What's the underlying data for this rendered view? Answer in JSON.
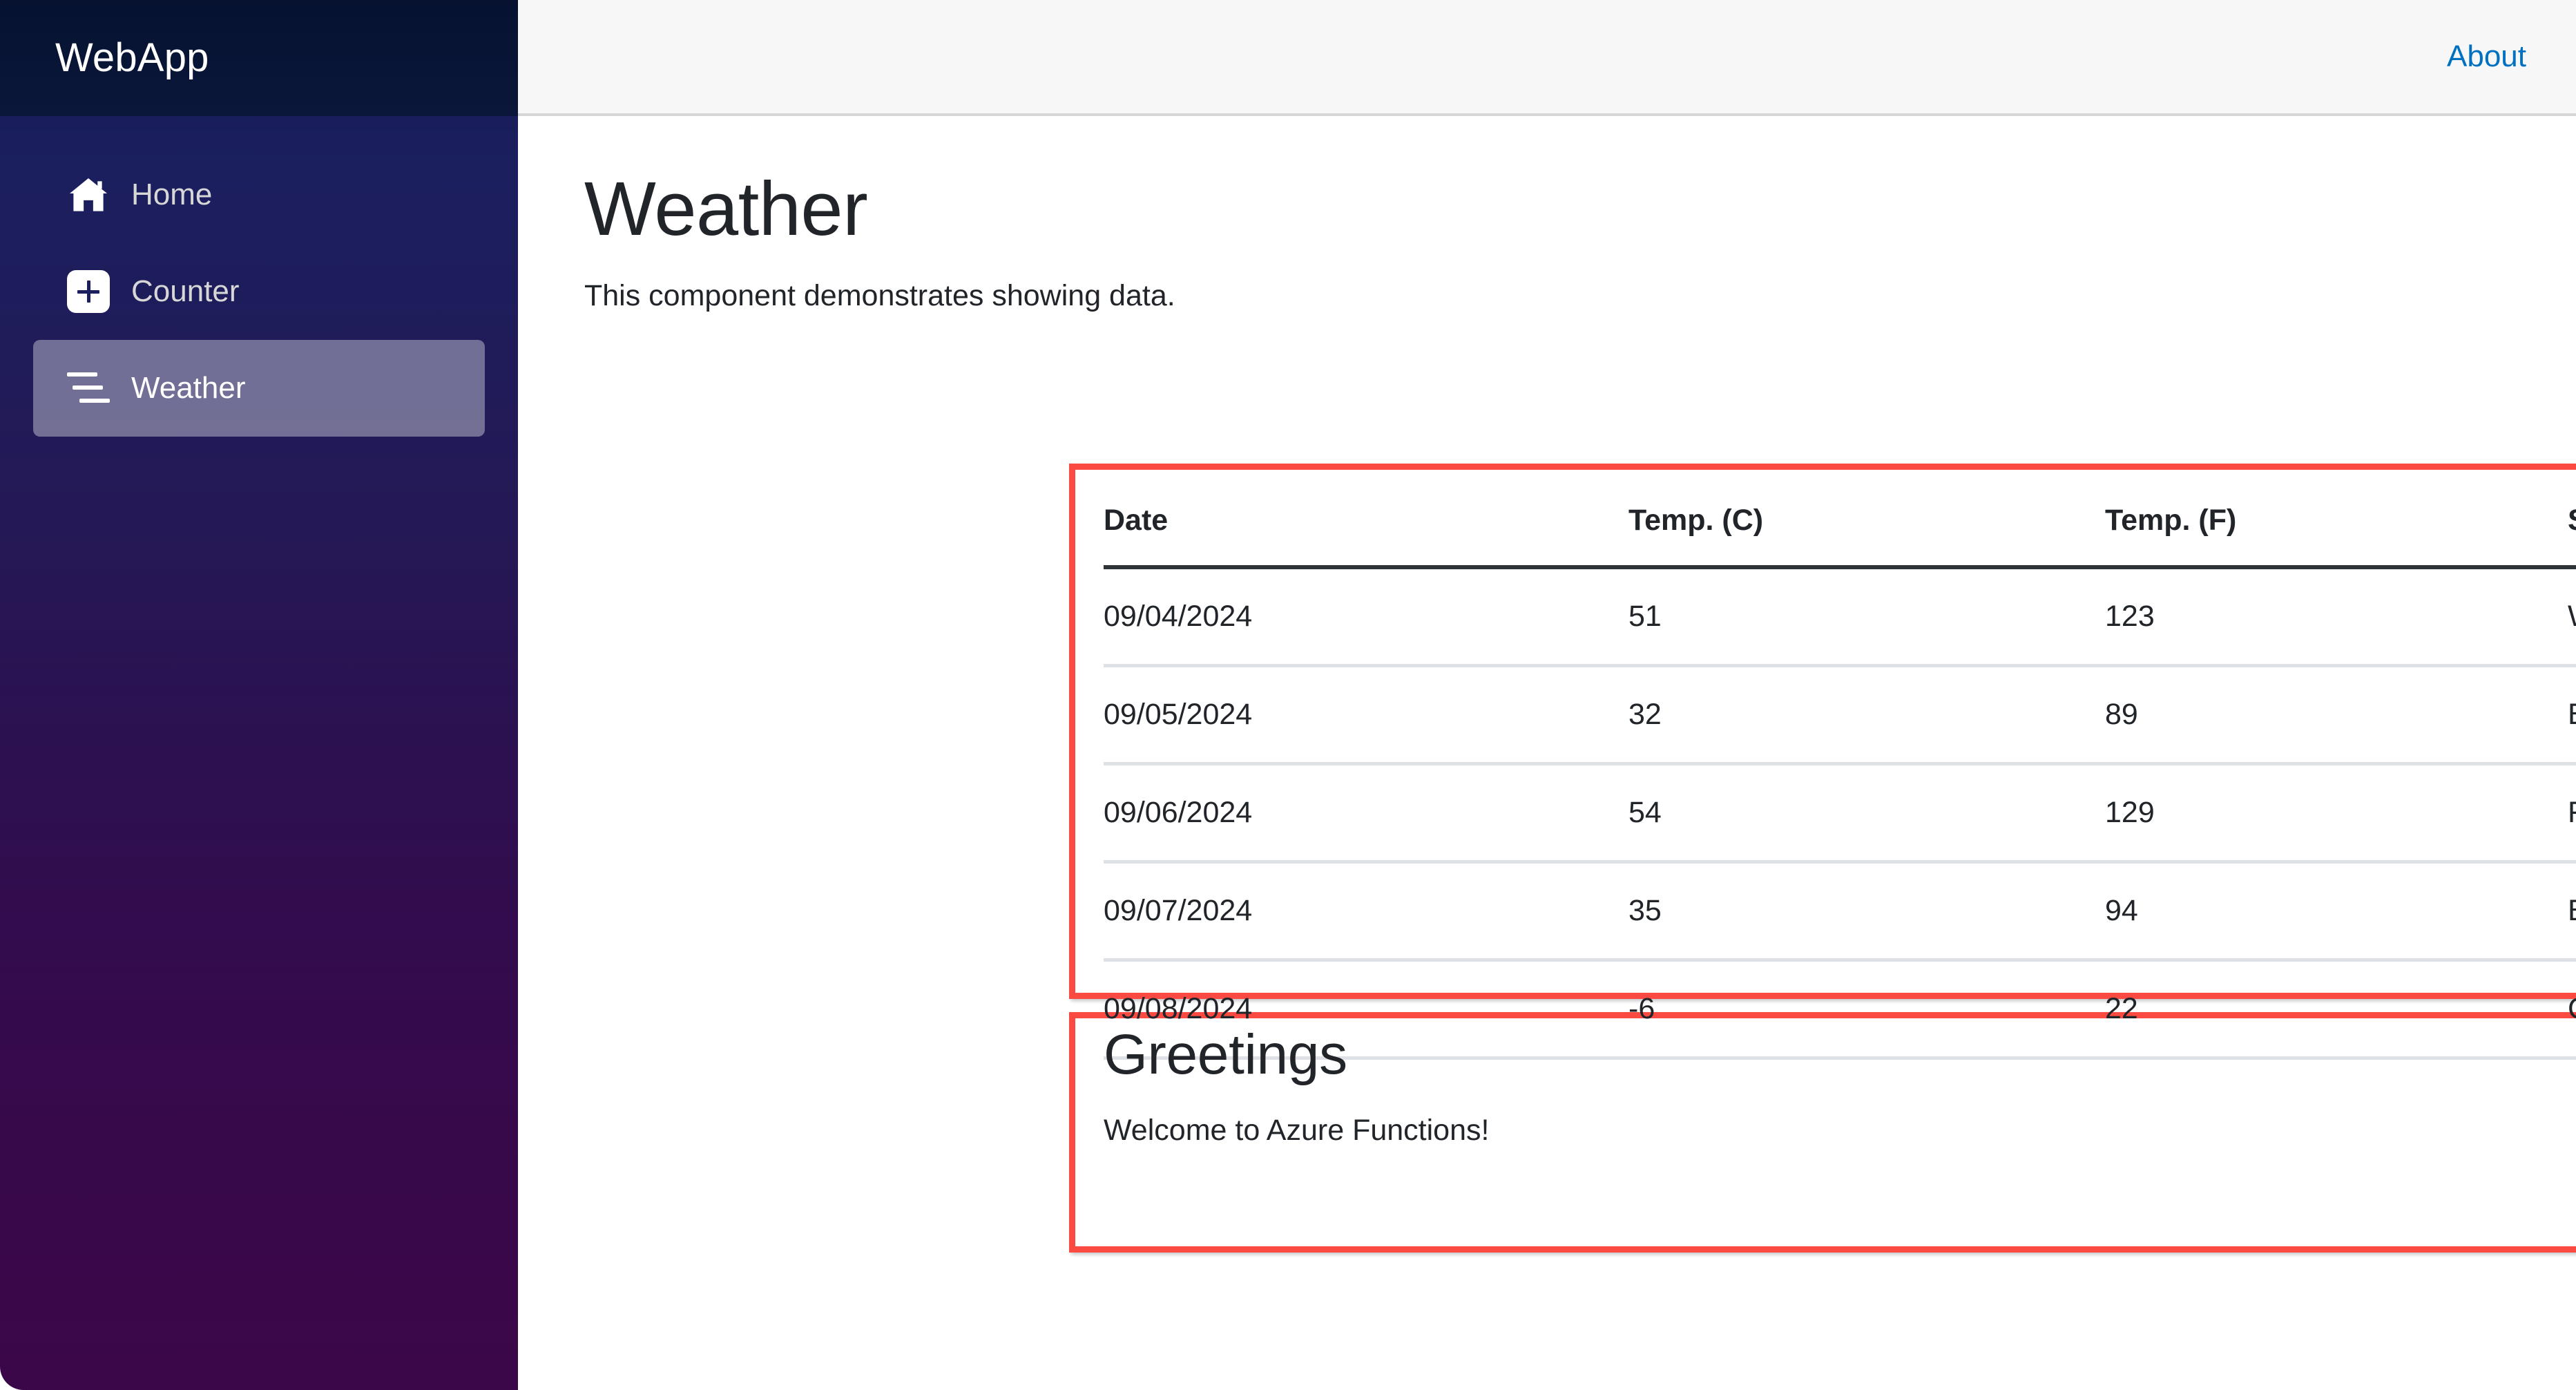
{
  "brand": {
    "title": "WebApp"
  },
  "sidebar": {
    "items": [
      {
        "label": "Home",
        "icon": "home-icon",
        "active": false
      },
      {
        "label": "Counter",
        "icon": "plus-box-icon",
        "active": false
      },
      {
        "label": "Weather",
        "icon": "list-icon",
        "active": true
      }
    ]
  },
  "topbar": {
    "about_label": "About"
  },
  "page": {
    "title": "Weather",
    "subtitle": "This component demonstrates showing data."
  },
  "table": {
    "columns": [
      "Date",
      "Temp. (C)",
      "Temp. (F)",
      "Summary"
    ],
    "rows": [
      {
        "date": "09/04/2024",
        "c": "51",
        "f": "123",
        "summary": "Warm"
      },
      {
        "date": "09/05/2024",
        "c": "32",
        "f": "89",
        "summary": "Balmy"
      },
      {
        "date": "09/06/2024",
        "c": "54",
        "f": "129",
        "summary": "Freezing"
      },
      {
        "date": "09/07/2024",
        "c": "35",
        "f": "94",
        "summary": "Bracing"
      },
      {
        "date": "09/08/2024",
        "c": "-6",
        "f": "22",
        "summary": "Cool"
      }
    ]
  },
  "greetings": {
    "title": "Greetings",
    "message": "Welcome to Azure Functions!"
  },
  "colors": {
    "highlight_border": "#fb4a42",
    "link": "#0071c1",
    "sidebar_top": "#1b1f5e",
    "sidebar_bottom": "#3c0748",
    "active_nav": "rgba(255,255,255,0.37)",
    "topbar_bg": "#f7f7f7",
    "text": "#212529"
  }
}
